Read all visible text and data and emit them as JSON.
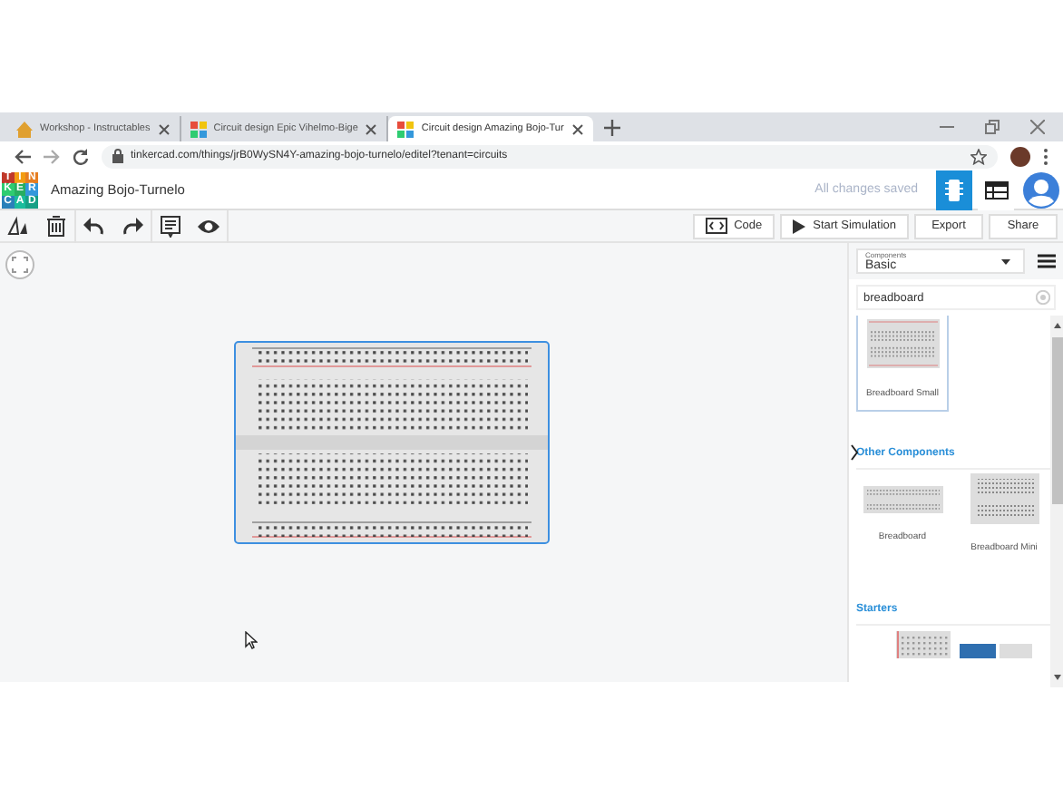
{
  "browser": {
    "tabs": [
      {
        "title": "Workshop - Instructables",
        "selected": false
      },
      {
        "title": "Circuit design Epic Vihelmo-Bige",
        "selected": false
      },
      {
        "title": "Circuit design Amazing Bojo-Tur",
        "selected": true
      }
    ],
    "url": "tinkercad.com/things/jrB0WySN4Y-amazing-bojo-turnelo/editel?tenant=circuits"
  },
  "header": {
    "logo": [
      "T",
      "I",
      "N",
      "K",
      "E",
      "R",
      "C",
      "A",
      "D"
    ],
    "title": "Amazing Bojo-Turnelo",
    "status": "All changes saved"
  },
  "toolbar": {
    "buttons": [
      {
        "label": "Code",
        "kind": "code"
      },
      {
        "label": "Start Simulation",
        "kind": "play"
      },
      {
        "label": "Export",
        "kind": "plain"
      },
      {
        "label": "Share",
        "kind": "plain"
      }
    ]
  },
  "sidebar": {
    "dropdown": {
      "label": "Components",
      "value": "Basic"
    },
    "search": {
      "value": "breadboard"
    },
    "results": [
      {
        "label": "Breadboard Small",
        "kind": "small"
      }
    ],
    "sections": [
      {
        "title": "Other Components",
        "items": [
          {
            "label": "Breadboard",
            "kind": "wide"
          },
          {
            "label": "Breadboard Mini",
            "kind": "mini"
          }
        ]
      },
      {
        "title": "Starters"
      }
    ]
  }
}
